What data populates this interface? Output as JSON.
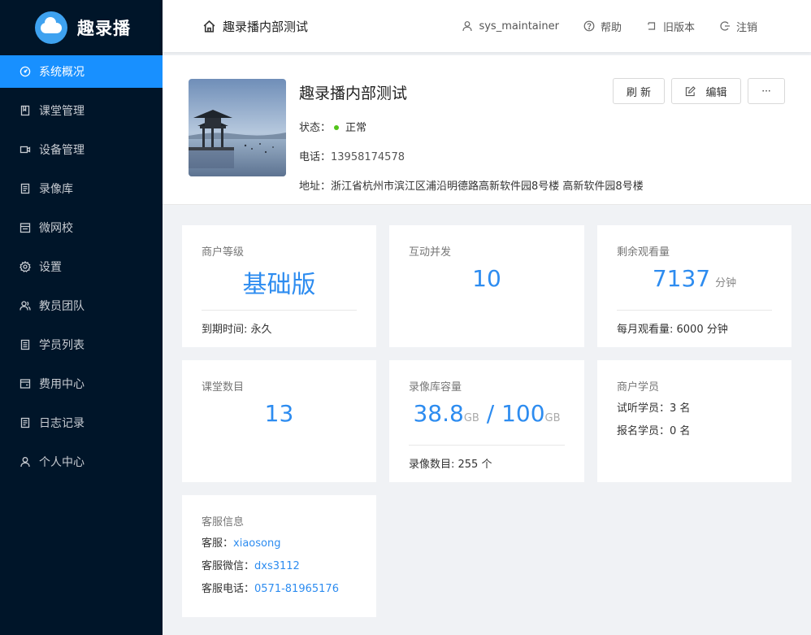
{
  "app": {
    "name": "趣录播",
    "logo_icon": "cloud-logo-icon",
    "accent": "#1890ff",
    "sidebar_bg": "#001529"
  },
  "sidebar": {
    "items": [
      {
        "label": "系统概况",
        "icon": "dashboard-icon",
        "active": true
      },
      {
        "label": "课堂管理",
        "icon": "book-icon"
      },
      {
        "label": "设备管理",
        "icon": "camera-icon"
      },
      {
        "label": "录像库",
        "icon": "library-icon"
      },
      {
        "label": "微网校",
        "icon": "school-icon"
      },
      {
        "label": "设置",
        "icon": "gear-icon"
      },
      {
        "label": "教员团队",
        "icon": "team-icon"
      },
      {
        "label": "学员列表",
        "icon": "list-icon"
      },
      {
        "label": "费用中心",
        "icon": "wallet-icon"
      },
      {
        "label": "日志记录",
        "icon": "log-icon"
      },
      {
        "label": "个人中心",
        "icon": "user-icon"
      }
    ]
  },
  "topbar": {
    "breadcrumb": "趣录播内部测试",
    "user": "sys_maintainer",
    "help": "帮助",
    "old_version": "旧版本",
    "logout": "注销"
  },
  "profile": {
    "title": "趣录播内部测试",
    "status_label": "状态：",
    "status_value": "正常",
    "status_color": "#52c41a",
    "phone_label": "电话：",
    "phone_value": "13958174578",
    "address_label": "地址：",
    "address_value": "浙江省杭州市滨江区浦沿明德路高新软件园8号楼 高新软件园8号楼",
    "refresh_label": "刷 新",
    "edit_label": "编辑",
    "more_label": "···"
  },
  "cards": {
    "level": {
      "label": "商户等级",
      "value": "基础版",
      "foot": "到期时间: 永久"
    },
    "concurrency": {
      "label": "互动并发",
      "value": "10"
    },
    "remaining": {
      "label": "剩余观看量",
      "value": "7137",
      "unit": "分钟",
      "foot": "每月观看量: 6000 分钟"
    },
    "classrooms": {
      "label": "课堂数目",
      "value": "13"
    },
    "storage": {
      "label": "录像库容量",
      "used": "38.8",
      "used_unit": "GB",
      "sep": " / ",
      "total": "100",
      "total_unit": "GB",
      "foot": "录像数目: 255 个"
    },
    "students": {
      "label": "商户学员",
      "trial": "试听学员：3 名",
      "enrolled": "报名学员：0 名"
    },
    "service": {
      "label": "客服信息",
      "agent_label": "客服：",
      "agent_value": "xiaosong",
      "wechat_label": "客服微信：",
      "wechat_value": "dxs3112",
      "phone_label": "客服电话：",
      "phone_value": "0571-81965176"
    }
  }
}
